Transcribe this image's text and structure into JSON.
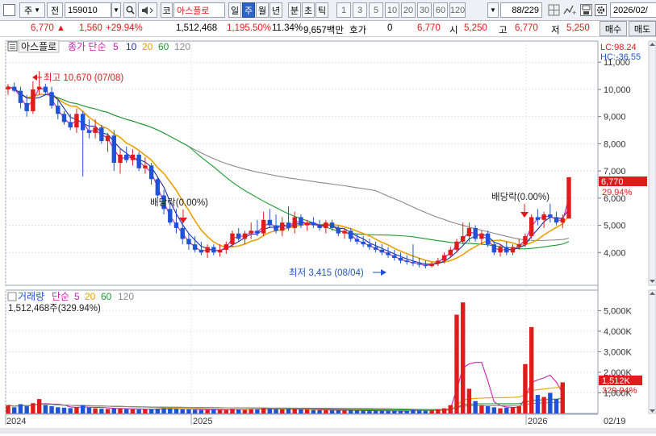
{
  "toolbar": {
    "market_sel": "주",
    "prev_label": "전",
    "code_value": "159010",
    "market_badge": "코",
    "stock_name": "아스플로",
    "period_buttons": [
      "일",
      "주",
      "월",
      "년",
      "분",
      "초",
      "틱"
    ],
    "active_period": "주",
    "number_buttons": [
      "1",
      "3",
      "5",
      "10",
      "20",
      "30",
      "60",
      "120"
    ],
    "count_value": "88",
    "count_total": "/229",
    "date_value": "2026/02/"
  },
  "quote": {
    "price": "6,770",
    "change": "1,560",
    "change_pct": "+29.94%",
    "volume": "1,512,468",
    "vol_ratio": "1,195.50%",
    "turnover": "11.34%",
    "amount": "9,657백만",
    "hoga_label": "호가",
    "hoga_value": "0",
    "ask_price": "6,770",
    "open_label": "시",
    "open_value": "5,250",
    "high_label": "고",
    "high_value": "6,770",
    "low_label": "저",
    "low_value": "5,250",
    "buy_button": "매수",
    "sell_button": "매도"
  },
  "price_panel": {
    "legend_name": "아스플로",
    "legend_ma_title": "종가 단순",
    "ma_periods": [
      "5",
      "10",
      "20",
      "60",
      "120"
    ],
    "lc_label": "LC:98.24",
    "hc_label": "HC:-36.55",
    "max_label": "최고 10,670 (07/08)",
    "min_label": "최저 3,415 (08/04)",
    "dividend_label_1": "배당락(0.00%)",
    "dividend_label_2": "배당락(0.00%)",
    "y_ticks": [
      "11,000",
      "10,000",
      "9,000",
      "8,000",
      "7,000",
      "6,000",
      "5,000",
      "4,000"
    ],
    "current_price_tag": "6,770",
    "current_pct_tag": "29.94%"
  },
  "volume_panel": {
    "legend_title": "거래량",
    "legend_ma_title": "단순",
    "ma_periods": [
      "5",
      "20",
      "60",
      "120"
    ],
    "current_label": "1,512,468주(329.94%)",
    "y_ticks": [
      "5,000K",
      "4,000K",
      "3,000K",
      "2,000K",
      "1,000K"
    ],
    "current_vol_tag": "1,512K",
    "current_vol_pct": "329.94%"
  },
  "x_axis": {
    "labels": [
      "2024",
      "2025",
      "2026",
      "02/19"
    ]
  },
  "colors": {
    "up": "#e01b1b",
    "down": "#1f52d6",
    "ma5": "#cc1fb0",
    "ma10": "#1a2fa8",
    "ma20": "#e8a100",
    "ma60": "#1c9a31",
    "ma120": "#8a8a8a"
  },
  "chart_data": {
    "type": "candlestick",
    "title": "아스플로",
    "x_range": [
      "2024",
      "2026/02/19"
    ],
    "price_ylim": [
      3000,
      11600
    ],
    "candles": [
      [
        10000,
        10200,
        9800,
        10100
      ],
      [
        10100,
        10250,
        9900,
        9950
      ],
      [
        9950,
        10100,
        9300,
        9500
      ],
      [
        9500,
        9800,
        9000,
        9200
      ],
      [
        9200,
        10300,
        9100,
        10000
      ],
      [
        10000,
        10670,
        9800,
        10100
      ],
      [
        10100,
        10200,
        9800,
        9900
      ],
      [
        9900,
        10100,
        9300,
        9400
      ],
      [
        9400,
        9600,
        8900,
        9100
      ],
      [
        9100,
        9200,
        8700,
        8800
      ],
      [
        8800,
        9100,
        8500,
        8600
      ],
      [
        8600,
        9300,
        8400,
        9100
      ],
      [
        9100,
        9200,
        6800,
        8500
      ],
      [
        8500,
        8900,
        8200,
        8400
      ],
      [
        8400,
        8900,
        8200,
        8600
      ],
      [
        8600,
        8700,
        8000,
        8100
      ],
      [
        8100,
        8400,
        7700,
        8300
      ],
      [
        8300,
        8500,
        7000,
        7300
      ],
      [
        7300,
        7800,
        6900,
        7600
      ],
      [
        7600,
        7900,
        7300,
        7400
      ],
      [
        7400,
        7800,
        7200,
        7600
      ],
      [
        7600,
        7700,
        7000,
        7100
      ],
      [
        7100,
        7500,
        6900,
        7200
      ],
      [
        7200,
        7300,
        6500,
        6700
      ],
      [
        6700,
        6800,
        6000,
        6100
      ],
      [
        6100,
        6300,
        5400,
        5600
      ],
      [
        5600,
        5800,
        5000,
        5100
      ],
      [
        5100,
        5600,
        4700,
        4900
      ],
      [
        4900,
        5100,
        4300,
        4500
      ],
      [
        4500,
        4700,
        4100,
        4300
      ],
      [
        4300,
        4600,
        4000,
        4100
      ],
      [
        4100,
        4400,
        3900,
        4000
      ],
      [
        4000,
        4300,
        3800,
        4200
      ],
      [
        4200,
        4300,
        3900,
        4000
      ],
      [
        4000,
        4300,
        3850,
        4100
      ],
      [
        4100,
        4400,
        3950,
        4300
      ],
      [
        4300,
        4800,
        4200,
        4700
      ],
      [
        4700,
        4900,
        4400,
        4500
      ],
      [
        4500,
        4800,
        4300,
        4700
      ],
      [
        4700,
        5100,
        4500,
        4800
      ],
      [
        4800,
        5200,
        4600,
        4700
      ],
      [
        4700,
        5500,
        4600,
        5200
      ],
      [
        5200,
        5600,
        4900,
        5000
      ],
      [
        5000,
        5400,
        4700,
        4800
      ],
      [
        4800,
        5300,
        4600,
        5100
      ],
      [
        5100,
        5700,
        4800,
        4900
      ],
      [
        4900,
        5500,
        4700,
        5300
      ],
      [
        5300,
        5400,
        4900,
        5000
      ],
      [
        5000,
        5200,
        4800,
        5100
      ],
      [
        5100,
        5300,
        4900,
        5000
      ],
      [
        5000,
        5200,
        4800,
        4900
      ],
      [
        4900,
        5200,
        4700,
        5100
      ],
      [
        5100,
        5200,
        4800,
        4900
      ],
      [
        4900,
        5000,
        4600,
        4700
      ],
      [
        4700,
        4900,
        4500,
        4800
      ],
      [
        4800,
        4900,
        4400,
        4500
      ],
      [
        4500,
        4700,
        4300,
        4400
      ],
      [
        4400,
        4600,
        4200,
        4300
      ],
      [
        4300,
        4500,
        4100,
        4200
      ],
      [
        4200,
        4400,
        4000,
        4100
      ],
      [
        4100,
        4300,
        3900,
        4000
      ],
      [
        4000,
        4200,
        3800,
        3900
      ],
      [
        3900,
        4100,
        3700,
        3800
      ],
      [
        3800,
        4000,
        3600,
        3700
      ],
      [
        3700,
        3900,
        3550,
        3650
      ],
      [
        3650,
        4300,
        3500,
        3600
      ],
      [
        3600,
        3800,
        3450,
        3550
      ],
      [
        3550,
        3700,
        3415,
        3500
      ],
      [
        3500,
        3650,
        3450,
        3600
      ],
      [
        3600,
        3800,
        3500,
        3700
      ],
      [
        3700,
        4000,
        3600,
        3900
      ],
      [
        3900,
        4200,
        3800,
        4100
      ],
      [
        4100,
        4500,
        4000,
        4400
      ],
      [
        4400,
        5100,
        4300,
        4600
      ],
      [
        4600,
        5100,
        4400,
        4900
      ],
      [
        4900,
        5000,
        4400,
        4500
      ],
      [
        4500,
        4800,
        4300,
        4700
      ],
      [
        4700,
        4800,
        4200,
        4300
      ],
      [
        4300,
        4400,
        3900,
        4000
      ],
      [
        4000,
        4300,
        3850,
        4200
      ],
      [
        4200,
        4400,
        3900,
        4000
      ],
      [
        4000,
        4300,
        3900,
        4200
      ],
      [
        4200,
        4500,
        4100,
        4300
      ],
      [
        4300,
        4700,
        4200,
        4600
      ],
      [
        4600,
        5400,
        4500,
        5300
      ],
      [
        5300,
        5600,
        5000,
        5200
      ],
      [
        5200,
        5500,
        4900,
        5400
      ],
      [
        5400,
        5800,
        5100,
        5300
      ],
      [
        5300,
        5500,
        5000,
        5100
      ],
      [
        5100,
        5400,
        4900,
        5250
      ],
      [
        5250,
        6770,
        5250,
        6770
      ]
    ],
    "volume_ylim": [
      0,
      5800000
    ],
    "volumes": [
      400000,
      300000,
      450000,
      350000,
      500000,
      700000,
      400000,
      350000,
      300000,
      280000,
      260000,
      300000,
      400000,
      280000,
      250000,
      230000,
      220000,
      250000,
      240000,
      210000,
      200000,
      190000,
      200000,
      210000,
      230000,
      250000,
      240000,
      220000,
      200000,
      190000,
      180000,
      170000,
      190000,
      200000,
      180000,
      170000,
      220000,
      190000,
      180000,
      210000,
      200000,
      250000,
      230000,
      210000,
      200000,
      220000,
      210000,
      190000,
      180000,
      170000,
      160000,
      170000,
      160000,
      150000,
      140000,
      150000,
      140000,
      130000,
      140000,
      130000,
      120000,
      130000,
      120000,
      110000,
      120000,
      180000,
      150000,
      140000,
      160000,
      200000,
      250000,
      400000,
      4800000,
      5400000,
      1200000,
      600000,
      400000,
      350000,
      300000,
      250000,
      280000,
      300000,
      350000,
      2400000,
      4200000,
      900000,
      800000,
      1000000,
      700000,
      1512468
    ]
  }
}
